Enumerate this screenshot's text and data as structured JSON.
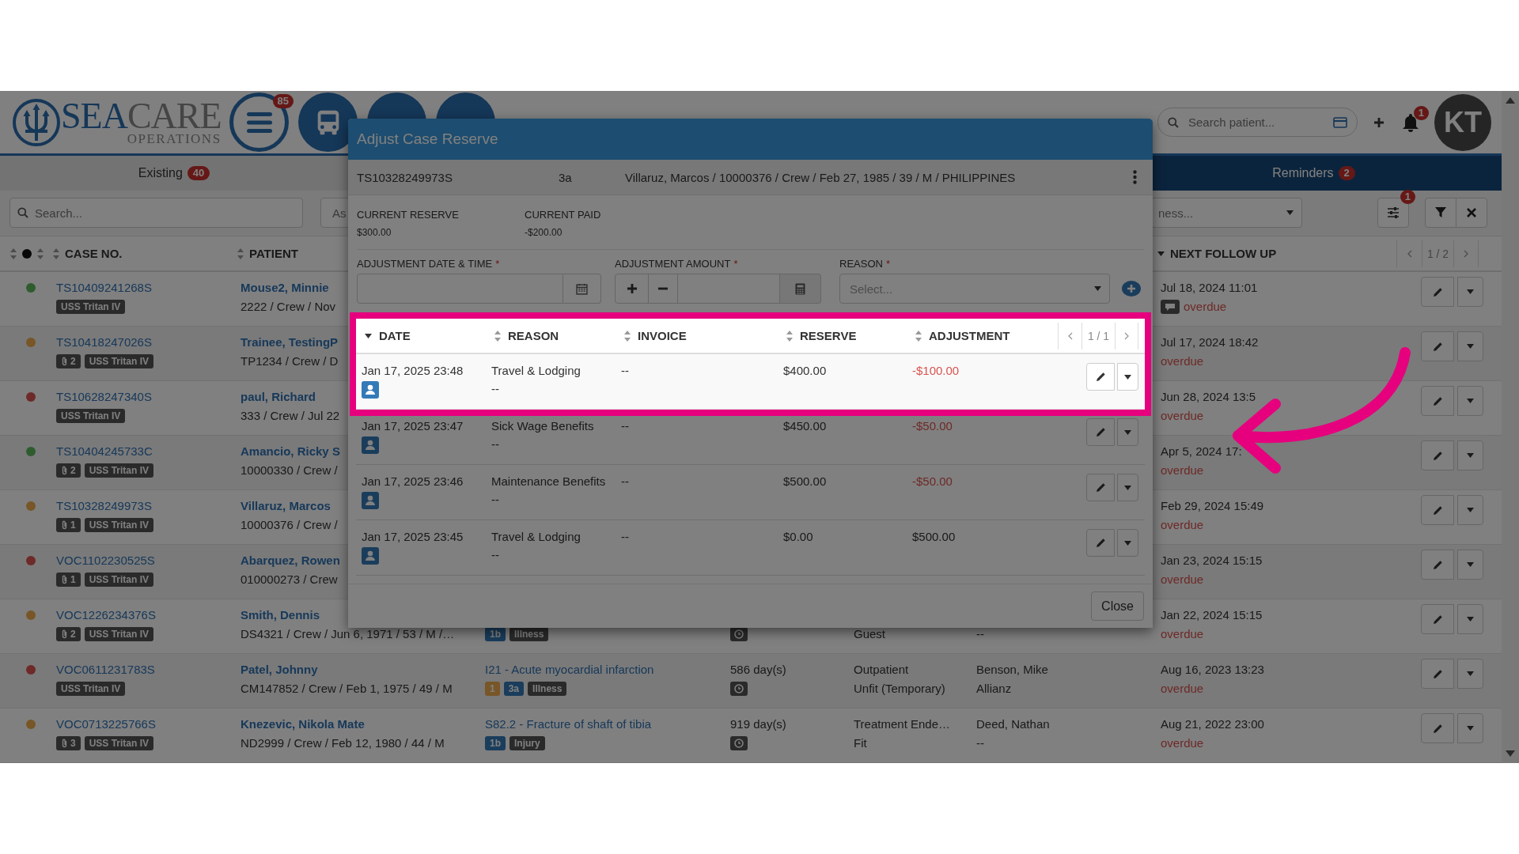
{
  "header": {
    "logo": {
      "title_a": "SEA",
      "title_b": "CARE",
      "subtitle": "OPERATIONS"
    },
    "menu_badge": "85",
    "search": {
      "placeholder": "Search patient..."
    },
    "notification_badge": "1",
    "avatar": "KT"
  },
  "tabs": [
    {
      "label": "Existing",
      "count": "40",
      "selected": false
    },
    {
      "label": "Reminders",
      "count": "2",
      "selected": true
    }
  ],
  "filters": {
    "search": {
      "placeholder": "Search..."
    },
    "select_1": "As",
    "select_2": "ness...",
    "settings_badge": "1"
  },
  "table": {
    "columns": [
      {
        "label": "CASE NO.",
        "sorted": false
      },
      {
        "label": "PATIENT",
        "sorted": false
      },
      {
        "label": "NEXT FOLLOW UP",
        "sorted": true
      }
    ],
    "pager": "1 / 2",
    "rows": [
      {
        "color": "#2e5c2e",
        "case_no": "TS10409241268S",
        "tags": [
          {
            "text": "USS Tritan IV",
            "kind": "vessel"
          }
        ],
        "patient_name": "Mouse2, Minnie",
        "patient_details": "2222 / Crew / Nov",
        "follow_up": "Jul 18, 2024 11:01",
        "comment": true,
        "overdue": "overdue"
      },
      {
        "color": "#785627",
        "case_no": "TS10418247026S",
        "tags": [
          {
            "text": "2",
            "kind": "attachment"
          },
          {
            "text": "USS Tritan IV",
            "kind": "vessel"
          }
        ],
        "patient_name": "Trainee, TestingP",
        "patient_details": "TP1234 / Crew / D",
        "follow_up": "Jul 17, 2024 18:42",
        "comment": false,
        "overdue": "overdue"
      },
      {
        "color": "#6d2a28",
        "case_no": "TS10628247340S",
        "tags": [
          {
            "text": "USS Tritan IV",
            "kind": "vessel"
          }
        ],
        "patient_name": "paul, Richard",
        "patient_details": "333 / Crew / Jul 22",
        "follow_up": "Jun 28, 2024 13:5",
        "comment": false,
        "overdue": "overdue"
      },
      {
        "color": "#2e5c2e",
        "case_no": "TS10404245733C",
        "tags": [
          {
            "text": "2",
            "kind": "attachment"
          },
          {
            "text": "USS Tritan IV",
            "kind": "vessel"
          }
        ],
        "patient_name": "Amancio, Ricky S",
        "patient_details": "10000330 / Crew /",
        "follow_up": "Apr 5, 2024 17:",
        "comment": false,
        "overdue": "overdue"
      },
      {
        "color": "#785627",
        "case_no": "TS10328249973S",
        "tags": [
          {
            "text": "1",
            "kind": "attachment"
          },
          {
            "text": "USS Tritan IV",
            "kind": "vessel"
          }
        ],
        "patient_name": "Villaruz, Marcos",
        "patient_details": "10000376 / Crew /",
        "follow_up": "Feb 29, 2024 15:49",
        "comment": false,
        "overdue": "overdue"
      },
      {
        "color": "#6d2a28",
        "case_no": "VOC1102230525S",
        "tags": [
          {
            "text": "1",
            "kind": "attachment"
          },
          {
            "text": "USS Tritan IV",
            "kind": "vessel"
          }
        ],
        "patient_name": "Abarquez, Rowen",
        "patient_details": "010000273 / Crew",
        "follow_up": "Jan 23, 2024 15:15",
        "comment": false,
        "overdue": "overdue"
      },
      {
        "color": "#785627",
        "case_no": "VOC1226234376S",
        "tags": [
          {
            "text": "2",
            "kind": "attachment"
          },
          {
            "text": "USS Tritan IV",
            "kind": "vessel"
          }
        ],
        "patient_name": "Smith, Dennis",
        "patient_details": "DS4321 / Crew / Jun 6, 1971 / 53 / M /…",
        "diagnosis_tags": [
          {
            "text": "1b",
            "kind": "grade"
          },
          {
            "text": "Illness",
            "kind": "category"
          }
        ],
        "timer": true,
        "status_2": "Guest",
        "contact_2": "--",
        "follow_up": "Jan 22, 2024 15:15",
        "comment": false,
        "overdue": "overdue"
      },
      {
        "color": "#6d2a28",
        "case_no": "VOC0611231783S",
        "tags": [
          {
            "text": "USS Tritan IV",
            "kind": "vessel"
          }
        ],
        "patient_name": "Patel, Johnny",
        "patient_details": "CM147852 / Crew / Feb 1, 1975 / 49 / M",
        "diagnosis": "I21 - Acute myocardial infarction",
        "diagnosis_tags": [
          {
            "text": "1",
            "kind": "priority"
          },
          {
            "text": "3a",
            "kind": "grade"
          },
          {
            "text": "Illness",
            "kind": "category"
          }
        ],
        "days": "586 day(s)",
        "timer": true,
        "status_1": "Outpatient",
        "status_2": "Unfit (Temporary)",
        "contact_1": "Benson, Mike",
        "contact_2": "Allianz",
        "follow_up": "Aug 16, 2023 13:23",
        "comment": false,
        "overdue": "overdue"
      },
      {
        "color": "#785627",
        "case_no": "VOC0713225766S",
        "tags": [
          {
            "text": "3",
            "kind": "attachment"
          },
          {
            "text": "USS Tritan IV",
            "kind": "vessel"
          }
        ],
        "patient_name": "Knezevic, Nikola Mate",
        "patient_details": "ND2999 / Crew / Feb 12, 1980 / 44 / M",
        "diagnosis": "S82.2 - Fracture of shaft of tibia",
        "diagnosis_tags": [
          {
            "text": "1b",
            "kind": "grade"
          },
          {
            "text": "Injury",
            "kind": "category"
          }
        ],
        "days": "919 day(s)",
        "timer": true,
        "status_1": "Treatment Ende…",
        "status_2": "Fit",
        "contact_1": "Deed, Nathan",
        "contact_2": "--",
        "follow_up": "Aug 21, 2022 23:00",
        "comment": false,
        "overdue": "overdue"
      }
    ]
  },
  "modal": {
    "title": "Adjust Case Reserve",
    "case_no": "TS10328249973S",
    "grade": "3a",
    "patient": "Villaruz, Marcos / 10000376 / Crew / Feb 27, 1985 / 39 / M / PHILIPPINES",
    "summary": [
      {
        "label": "CURRENT RESERVE",
        "value": "$300.00"
      },
      {
        "label": "CURRENT PAID",
        "value": "-$200.00"
      }
    ],
    "form": {
      "required_mark": "*",
      "fields": [
        {
          "label": "ADJUSTMENT DATE & TIME",
          "kind": "date",
          "required": true
        },
        {
          "label": "ADJUSTMENT AMOUNT",
          "kind": "amount",
          "required": true
        },
        {
          "label": "REASON",
          "kind": "select",
          "required": true,
          "placeholder": "Select..."
        }
      ]
    },
    "table": {
      "columns": [
        {
          "label": "DATE",
          "sorted": true
        },
        {
          "label": "REASON",
          "sorted": false
        },
        {
          "label": "INVOICE",
          "sorted": false
        },
        {
          "label": "RESERVE",
          "sorted": false
        },
        {
          "label": "ADJUSTMENT",
          "sorted": false
        }
      ],
      "pager": "1 / 1",
      "rows": [
        {
          "date": "Jan 17, 2025 23:48",
          "reason": "Travel & Lodging",
          "note": "--",
          "invoice": "--",
          "reserve": "$400.00",
          "adjustment": "-$100.00",
          "negative": true,
          "highlighted": true
        },
        {
          "date": "Jan 17, 2025 23:47",
          "reason": "Sick Wage Benefits",
          "note": "--",
          "invoice": "--",
          "reserve": "$450.00",
          "adjustment": "-$50.00",
          "negative": true,
          "highlighted": false
        },
        {
          "date": "Jan 17, 2025 23:46",
          "reason": "Maintenance Benefits",
          "note": "--",
          "invoice": "--",
          "reserve": "$500.00",
          "adjustment": "-$50.00",
          "negative": true,
          "highlighted": false
        },
        {
          "date": "Jan 17, 2025 23:45",
          "reason": "Travel & Lodging",
          "note": "--",
          "invoice": "--",
          "reserve": "$0.00",
          "adjustment": "$500.00",
          "negative": false,
          "highlighted": false
        }
      ]
    },
    "close": "Close"
  }
}
